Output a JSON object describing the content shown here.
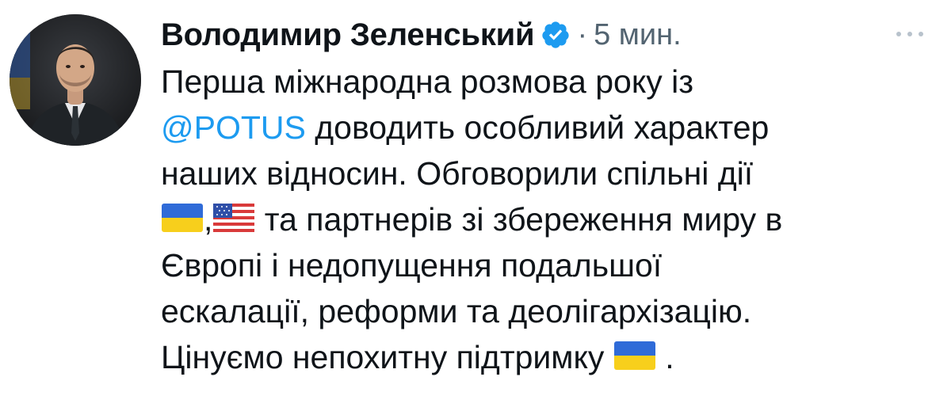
{
  "author": {
    "name": "Володимир Зеленський",
    "verified": true
  },
  "meta": {
    "separator": "·",
    "time": "5 мин."
  },
  "tweet": {
    "line1": "Перша міжнародна розмова року із",
    "mention": "@POTUS",
    "line2_rest": " доводить особливий характер",
    "line3": "наших відносин. Обговорили спільні дії",
    "line4_comma": ",",
    "line4_rest": " та партнерів зі збереження миру в",
    "line5": "Європі і недопущення подальшої",
    "line6": "ескалації, реформи та деолігархізацію.",
    "line7": "Цінуємо непохитну підтримку",
    "line7_end": " ."
  },
  "icons": {
    "verified": "verified-badge-icon",
    "more": "more-options-icon",
    "flag_ua": "ukraine-flag-icon",
    "flag_us": "usa-flag-icon"
  },
  "colors": {
    "link": "#1d9bf0",
    "text": "#0f1419",
    "secondary": "#536471",
    "flag_blue": "#2f6bd8",
    "flag_yellow": "#f7cf1c"
  }
}
